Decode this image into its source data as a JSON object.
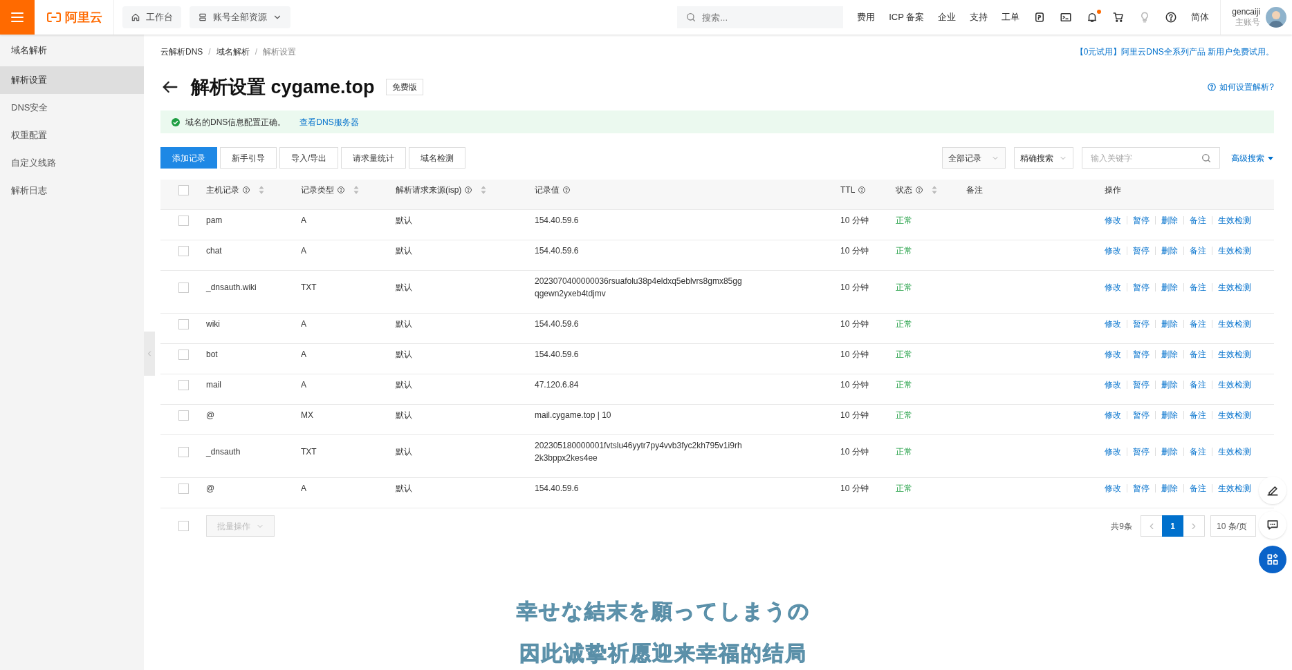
{
  "topbar": {
    "logo": "阿里云",
    "workbench": "工作台",
    "resources": "账号全部资源",
    "search_placeholder": "搜索...",
    "links": [
      "费用",
      "ICP 备案",
      "企业",
      "支持",
      "工单"
    ],
    "notification_dot": true,
    "language": "简体",
    "user": "gencaiji",
    "account_type": "主账号"
  },
  "sidebar": {
    "title": "域名解析",
    "items": [
      {
        "label": "解析设置",
        "selected": true
      },
      {
        "label": "DNS安全",
        "selected": false
      },
      {
        "label": "权重配置",
        "selected": false
      },
      {
        "label": "自定义线路",
        "selected": false
      },
      {
        "label": "解析日志",
        "selected": false
      }
    ]
  },
  "breadcrumb": [
    {
      "kind": "link",
      "label": "云解析DNS"
    },
    {
      "kind": "separator",
      "label": "/"
    },
    {
      "kind": "link",
      "label": "域名解析"
    },
    {
      "kind": "separator",
      "label": "/"
    },
    {
      "kind": "current",
      "label": "解析设置"
    }
  ],
  "promo": "【0元试用】阿里云DNS全系列产品 新用户免费试用。",
  "title": "解析设置 cygame.top",
  "edition": "免费版",
  "help_link": "如何设置解析?",
  "alert": {
    "text": "域名的DNS信息配置正确。",
    "link": "查看DNS服务器"
  },
  "toolbar": {
    "buttons": [
      {
        "label": "添加记录",
        "primary": true
      },
      {
        "label": "新手引导",
        "primary": false
      },
      {
        "label": "导入/导出",
        "primary": false
      },
      {
        "label": "请求量统计",
        "primary": false
      },
      {
        "label": "域名检测",
        "primary": false
      }
    ],
    "filter": "全部记录",
    "search_mode": "精确搜索",
    "keyword_placeholder": "输入关键字",
    "advanced": "高级搜索"
  },
  "table": {
    "select_all": false,
    "columns": [
      {
        "label": "主机记录",
        "help": true,
        "sortable": true
      },
      {
        "label": "记录类型",
        "help": true,
        "sortable": true
      },
      {
        "label": "解析请求来源(isp)",
        "help": true,
        "sortable": true
      },
      {
        "label": "记录值",
        "help": true,
        "sortable": false
      },
      {
        "label": "TTL",
        "help": true,
        "sortable": false
      },
      {
        "label": "状态",
        "help": true,
        "sortable": true
      },
      {
        "label": "备注",
        "help": false,
        "sortable": false
      },
      {
        "label": "操作",
        "help": false,
        "sortable": false
      }
    ],
    "rows": [
      {
        "host": "pam",
        "type": "A",
        "line": "默认",
        "value": "154.40.59.6",
        "ttl": "10 分钟",
        "status": "正常",
        "checked": false,
        "actions": [
          "修改",
          "暂停",
          "删除",
          "备注",
          "生效检测"
        ]
      },
      {
        "host": "chat",
        "type": "A",
        "line": "默认",
        "value": "154.40.59.6",
        "ttl": "10 分钟",
        "status": "正常",
        "checked": false,
        "actions": [
          "修改",
          "暂停",
          "删除",
          "备注",
          "生效检测"
        ]
      },
      {
        "host": "_dnsauth.wiki",
        "type": "TXT",
        "line": "默认",
        "value": "2023070400000036rsuafolu38p4eldxq5eblvrs8gmx85ggqgewn2yxeb4tdjmv",
        "ttl": "10 分钟",
        "status": "正常",
        "checked": false,
        "actions": [
          "修改",
          "暂停",
          "删除",
          "备注",
          "生效检测"
        ]
      },
      {
        "host": "wiki",
        "type": "A",
        "line": "默认",
        "value": "154.40.59.6",
        "ttl": "10 分钟",
        "status": "正常",
        "checked": false,
        "actions": [
          "修改",
          "暂停",
          "删除",
          "备注",
          "生效检测"
        ]
      },
      {
        "host": "bot",
        "type": "A",
        "line": "默认",
        "value": "154.40.59.6",
        "ttl": "10 分钟",
        "status": "正常",
        "checked": false,
        "actions": [
          "修改",
          "暂停",
          "删除",
          "备注",
          "生效检测"
        ]
      },
      {
        "host": "mail",
        "type": "A",
        "line": "默认",
        "value": "47.120.6.84",
        "ttl": "10 分钟",
        "status": "正常",
        "checked": false,
        "actions": [
          "修改",
          "暂停",
          "删除",
          "备注",
          "生效检测"
        ]
      },
      {
        "host": "@",
        "type": "MX",
        "line": "默认",
        "value": "mail.cygame.top | 10",
        "ttl": "10 分钟",
        "status": "正常",
        "checked": false,
        "actions": [
          "修改",
          "暂停",
          "删除",
          "备注",
          "生效检测"
        ]
      },
      {
        "host": "_dnsauth",
        "type": "TXT",
        "line": "默认",
        "value": "202305180000001fvtslu46yytr7py4vvb3fyc2kh795v1i9rh2k3bppx2kes4ee",
        "ttl": "10 分钟",
        "status": "正常",
        "checked": false,
        "actions": [
          "修改",
          "暂停",
          "删除",
          "备注",
          "生效检测"
        ]
      },
      {
        "host": "@",
        "type": "A",
        "line": "默认",
        "value": "154.40.59.6",
        "ttl": "10 分钟",
        "status": "正常",
        "checked": false,
        "actions": [
          "修改",
          "暂停",
          "删除",
          "备注",
          "生效检测"
        ]
      }
    ]
  },
  "footer": {
    "select_all": false,
    "batch": "批量操作",
    "total": "共9条",
    "pages": [
      {
        "label": "1",
        "selected": true
      }
    ],
    "page_size": "10 条/页"
  },
  "subtitles": [
    "幸せな結末を願ってしまうの",
    "因此诚挚祈愿迎来幸福的结局"
  ]
}
